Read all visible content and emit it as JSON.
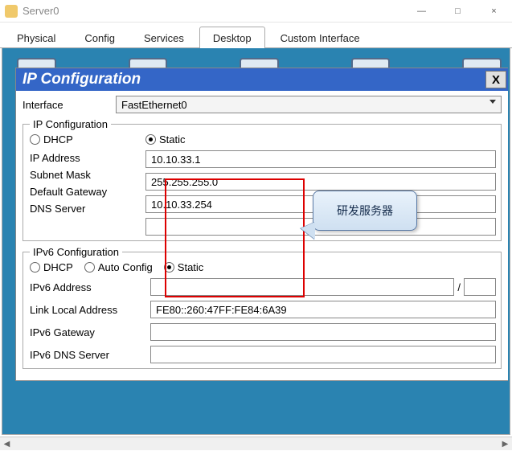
{
  "window": {
    "title": "Server0",
    "min": "—",
    "max": "□",
    "close": "×"
  },
  "tabs": [
    "Physical",
    "Config",
    "Services",
    "Desktop",
    "Custom Interface"
  ],
  "active_tab_index": 3,
  "dialog": {
    "title": "IP Configuration",
    "close": "X",
    "interface_label": "Interface",
    "interface_value": "FastEthernet0",
    "v4": {
      "legend": "IP Configuration",
      "radios": {
        "dhcp": "DHCP",
        "static": "Static",
        "selected": "static"
      },
      "fields": {
        "ip_label": "IP Address",
        "ip_value": "10.10.33.1",
        "mask_label": "Subnet Mask",
        "mask_value": "255.255.255.0",
        "gw_label": "Default Gateway",
        "gw_value": "10.10.33.254",
        "dns_label": "DNS Server",
        "dns_value": ""
      }
    },
    "v6": {
      "legend": "IPv6 Configuration",
      "radios": {
        "dhcp": "DHCP",
        "auto": "Auto Config",
        "static": "Static",
        "selected": "static"
      },
      "fields": {
        "addr_label": "IPv6 Address",
        "addr_value": "",
        "prefix_value": "",
        "ll_label": "Link Local Address",
        "ll_value": "FE80::260:47FF:FE84:6A39",
        "gw_label": "IPv6 Gateway",
        "gw_value": "",
        "dns_label": "IPv6 DNS Server",
        "dns_value": ""
      }
    }
  },
  "callout_text": "研发服务器"
}
